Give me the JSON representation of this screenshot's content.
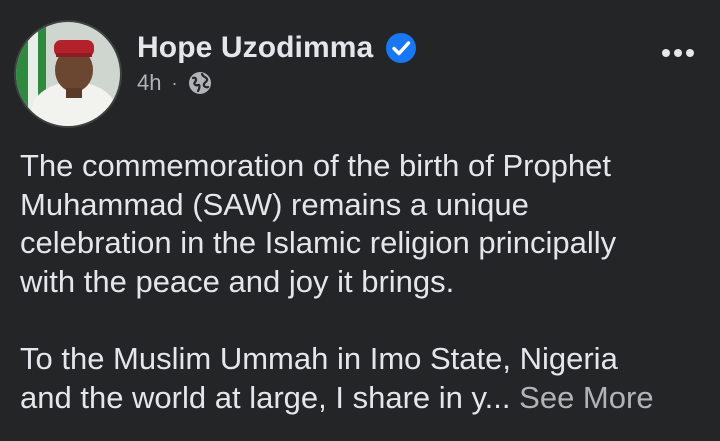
{
  "post": {
    "author": "Hope Uzodimma",
    "verified_icon": "verified-badge-icon",
    "time": "4h",
    "separator": "·",
    "audience_icon": "globe-icon",
    "more_icon": "more-options-icon",
    "paragraph1_lines": [
      "The commemoration of the birth of Prophet",
      "Muhammad (SAW) remains a unique",
      "celebration in the Islamic religion principally",
      "with the peace and joy it brings."
    ],
    "paragraph2_lines": [
      "To the Muslim Ummah in Imo State, Nigeria",
      "and the world at large, I share in y..."
    ],
    "see_more": "See More"
  },
  "colors": {
    "background": "#242526",
    "primary_text": "#e4e6eb",
    "secondary_text": "#b0b3b8",
    "verified_blue": "#1877f2"
  }
}
